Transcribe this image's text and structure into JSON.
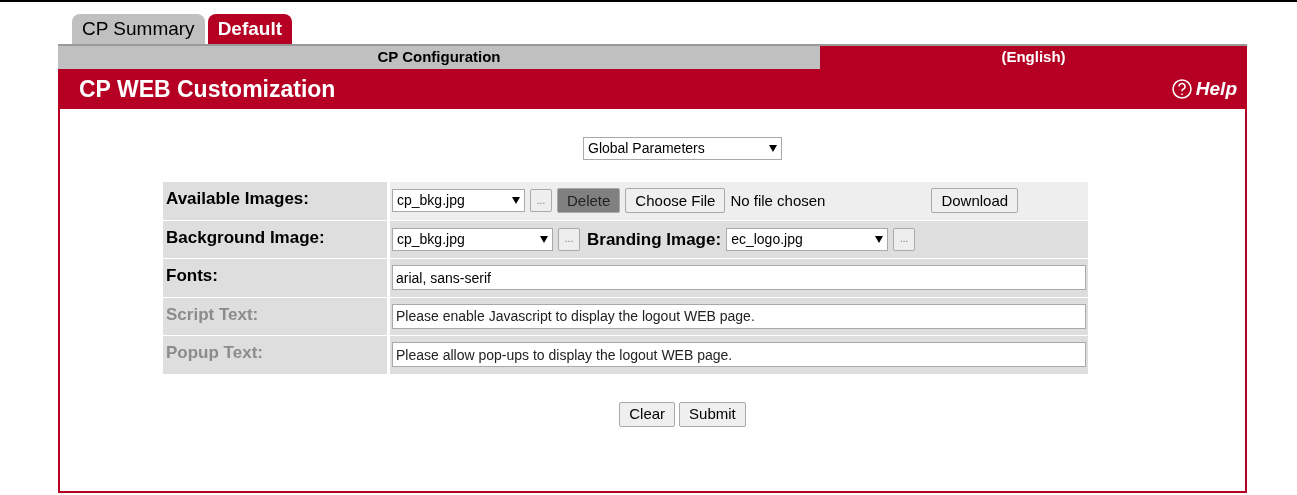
{
  "tabs": [
    {
      "label": "CP Summary",
      "selected": false
    },
    {
      "label": "Default",
      "selected": true
    }
  ],
  "sub_bar": {
    "configuration": "CP Configuration",
    "language": "(English)"
  },
  "header": {
    "title": "CP WEB Customization",
    "help": "Help"
  },
  "section_select": {
    "value": "Global Parameters"
  },
  "rows": [
    {
      "kind": "images",
      "label": "Available Images:",
      "disabled": false,
      "value": "cp_bkg.jpg",
      "browse": "...",
      "delete": "Delete",
      "choose": "Choose File",
      "file_status": "No file chosen",
      "download": "Download"
    },
    {
      "kind": "image-pair",
      "label": "Background Image:",
      "disabled": false,
      "value": "cp_bkg.jpg",
      "browse": "...",
      "second_label": "Branding Image:",
      "second_value": "ec_logo.jpg",
      "second_browse": "..."
    },
    {
      "kind": "text",
      "label": "Fonts:",
      "disabled": false,
      "value": "arial, sans-serif"
    },
    {
      "kind": "text",
      "label": "Script Text:",
      "disabled": true,
      "value": "Please enable Javascript to display the logout WEB page."
    },
    {
      "kind": "text",
      "label": "Popup Text:",
      "disabled": true,
      "value": "Please allow pop-ups to display the logout WEB page."
    }
  ],
  "buttons": [
    "Clear",
    "Submit"
  ]
}
